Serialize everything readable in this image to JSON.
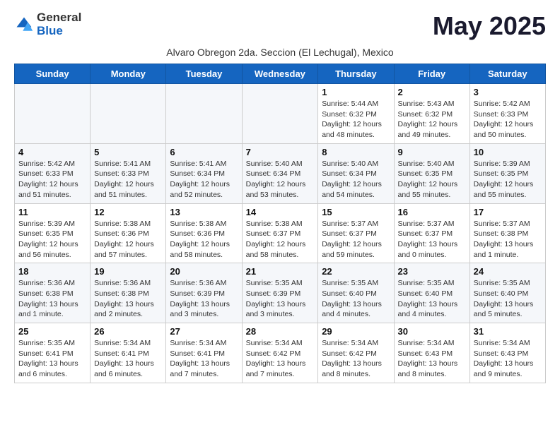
{
  "logo": {
    "general": "General",
    "blue": "Blue"
  },
  "header": {
    "month_year": "May 2025",
    "location": "Alvaro Obregon 2da. Seccion (El Lechugal), Mexico"
  },
  "weekdays": [
    "Sunday",
    "Monday",
    "Tuesday",
    "Wednesday",
    "Thursday",
    "Friday",
    "Saturday"
  ],
  "weeks": [
    [
      {
        "day": "",
        "info": ""
      },
      {
        "day": "",
        "info": ""
      },
      {
        "day": "",
        "info": ""
      },
      {
        "day": "",
        "info": ""
      },
      {
        "day": "1",
        "info": "Sunrise: 5:44 AM\nSunset: 6:32 PM\nDaylight: 12 hours\nand 48 minutes."
      },
      {
        "day": "2",
        "info": "Sunrise: 5:43 AM\nSunset: 6:32 PM\nDaylight: 12 hours\nand 49 minutes."
      },
      {
        "day": "3",
        "info": "Sunrise: 5:42 AM\nSunset: 6:33 PM\nDaylight: 12 hours\nand 50 minutes."
      }
    ],
    [
      {
        "day": "4",
        "info": "Sunrise: 5:42 AM\nSunset: 6:33 PM\nDaylight: 12 hours\nand 51 minutes."
      },
      {
        "day": "5",
        "info": "Sunrise: 5:41 AM\nSunset: 6:33 PM\nDaylight: 12 hours\nand 51 minutes."
      },
      {
        "day": "6",
        "info": "Sunrise: 5:41 AM\nSunset: 6:34 PM\nDaylight: 12 hours\nand 52 minutes."
      },
      {
        "day": "7",
        "info": "Sunrise: 5:40 AM\nSunset: 6:34 PM\nDaylight: 12 hours\nand 53 minutes."
      },
      {
        "day": "8",
        "info": "Sunrise: 5:40 AM\nSunset: 6:34 PM\nDaylight: 12 hours\nand 54 minutes."
      },
      {
        "day": "9",
        "info": "Sunrise: 5:40 AM\nSunset: 6:35 PM\nDaylight: 12 hours\nand 55 minutes."
      },
      {
        "day": "10",
        "info": "Sunrise: 5:39 AM\nSunset: 6:35 PM\nDaylight: 12 hours\nand 55 minutes."
      }
    ],
    [
      {
        "day": "11",
        "info": "Sunrise: 5:39 AM\nSunset: 6:35 PM\nDaylight: 12 hours\nand 56 minutes."
      },
      {
        "day": "12",
        "info": "Sunrise: 5:38 AM\nSunset: 6:36 PM\nDaylight: 12 hours\nand 57 minutes."
      },
      {
        "day": "13",
        "info": "Sunrise: 5:38 AM\nSunset: 6:36 PM\nDaylight: 12 hours\nand 58 minutes."
      },
      {
        "day": "14",
        "info": "Sunrise: 5:38 AM\nSunset: 6:37 PM\nDaylight: 12 hours\nand 58 minutes."
      },
      {
        "day": "15",
        "info": "Sunrise: 5:37 AM\nSunset: 6:37 PM\nDaylight: 12 hours\nand 59 minutes."
      },
      {
        "day": "16",
        "info": "Sunrise: 5:37 AM\nSunset: 6:37 PM\nDaylight: 13 hours\nand 0 minutes."
      },
      {
        "day": "17",
        "info": "Sunrise: 5:37 AM\nSunset: 6:38 PM\nDaylight: 13 hours\nand 1 minute."
      }
    ],
    [
      {
        "day": "18",
        "info": "Sunrise: 5:36 AM\nSunset: 6:38 PM\nDaylight: 13 hours\nand 1 minute."
      },
      {
        "day": "19",
        "info": "Sunrise: 5:36 AM\nSunset: 6:38 PM\nDaylight: 13 hours\nand 2 minutes."
      },
      {
        "day": "20",
        "info": "Sunrise: 5:36 AM\nSunset: 6:39 PM\nDaylight: 13 hours\nand 3 minutes."
      },
      {
        "day": "21",
        "info": "Sunrise: 5:35 AM\nSunset: 6:39 PM\nDaylight: 13 hours\nand 3 minutes."
      },
      {
        "day": "22",
        "info": "Sunrise: 5:35 AM\nSunset: 6:40 PM\nDaylight: 13 hours\nand 4 minutes."
      },
      {
        "day": "23",
        "info": "Sunrise: 5:35 AM\nSunset: 6:40 PM\nDaylight: 13 hours\nand 4 minutes."
      },
      {
        "day": "24",
        "info": "Sunrise: 5:35 AM\nSunset: 6:40 PM\nDaylight: 13 hours\nand 5 minutes."
      }
    ],
    [
      {
        "day": "25",
        "info": "Sunrise: 5:35 AM\nSunset: 6:41 PM\nDaylight: 13 hours\nand 6 minutes."
      },
      {
        "day": "26",
        "info": "Sunrise: 5:34 AM\nSunset: 6:41 PM\nDaylight: 13 hours\nand 6 minutes."
      },
      {
        "day": "27",
        "info": "Sunrise: 5:34 AM\nSunset: 6:41 PM\nDaylight: 13 hours\nand 7 minutes."
      },
      {
        "day": "28",
        "info": "Sunrise: 5:34 AM\nSunset: 6:42 PM\nDaylight: 13 hours\nand 7 minutes."
      },
      {
        "day": "29",
        "info": "Sunrise: 5:34 AM\nSunset: 6:42 PM\nDaylight: 13 hours\nand 8 minutes."
      },
      {
        "day": "30",
        "info": "Sunrise: 5:34 AM\nSunset: 6:43 PM\nDaylight: 13 hours\nand 8 minutes."
      },
      {
        "day": "31",
        "info": "Sunrise: 5:34 AM\nSunset: 6:43 PM\nDaylight: 13 hours\nand 9 minutes."
      }
    ]
  ]
}
